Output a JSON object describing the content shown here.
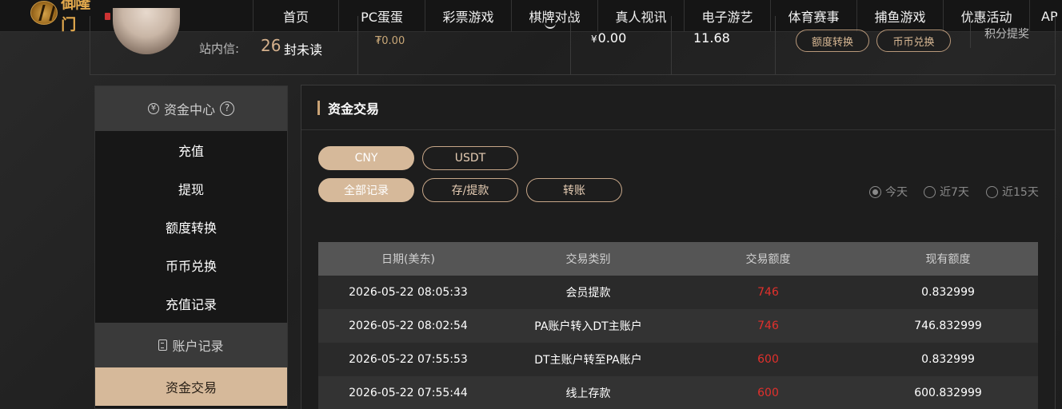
{
  "logo": {
    "text": "御隆门"
  },
  "nav": {
    "items": [
      "首页",
      "PC蛋蛋",
      "彩票游戏",
      "棋牌对战",
      "真人视讯",
      "电子游艺",
      "体育赛事",
      "捕鱼游戏",
      "优惠活动",
      "AP"
    ]
  },
  "user": {
    "mail_label": "站内信:",
    "mail_count": "26",
    "mail_unread": "封未读",
    "balance_small": "₮0.00",
    "balance_main_currency": "¥",
    "balance_main": "0.00",
    "balance_second": "11.68",
    "transfer_button": "额度转换",
    "exchange_button": "币币兑换",
    "points_text": "积分提奖"
  },
  "sidebar": {
    "fund_center": "资金中心",
    "help_symbol": "?",
    "fund_items": [
      "充值",
      "提现",
      "额度转换",
      "币币兑换",
      "充值记录"
    ],
    "account_records": "账户记录",
    "account_items": [
      "资金交易"
    ]
  },
  "panel": {
    "title": "资金交易",
    "currency_tabs": [
      "CNY",
      "USDT"
    ],
    "record_tabs": [
      "全部记录",
      "存/提款",
      "转账"
    ],
    "ranges": [
      "今天",
      "近7天",
      "近15天"
    ],
    "selected_range": "今天"
  },
  "table": {
    "headers": [
      "日期(美东)",
      "交易类别",
      "交易额度",
      "现有额度"
    ],
    "rows": [
      [
        "2026-05-22 08:05:33",
        "会员提款",
        "746",
        "0.832999"
      ],
      [
        "2026-05-22 08:02:54",
        "PA账户转入DT主账户",
        "746",
        "746.832999"
      ],
      [
        "2026-05-22 07:55:53",
        "DT主账户转至PA账户",
        "600",
        "0.832999"
      ],
      [
        "2026-05-22 07:55:44",
        "线上存款",
        "600",
        "600.832999"
      ]
    ]
  },
  "colors": {
    "accent": "#d6b99a",
    "amount": "#e2302c"
  }
}
